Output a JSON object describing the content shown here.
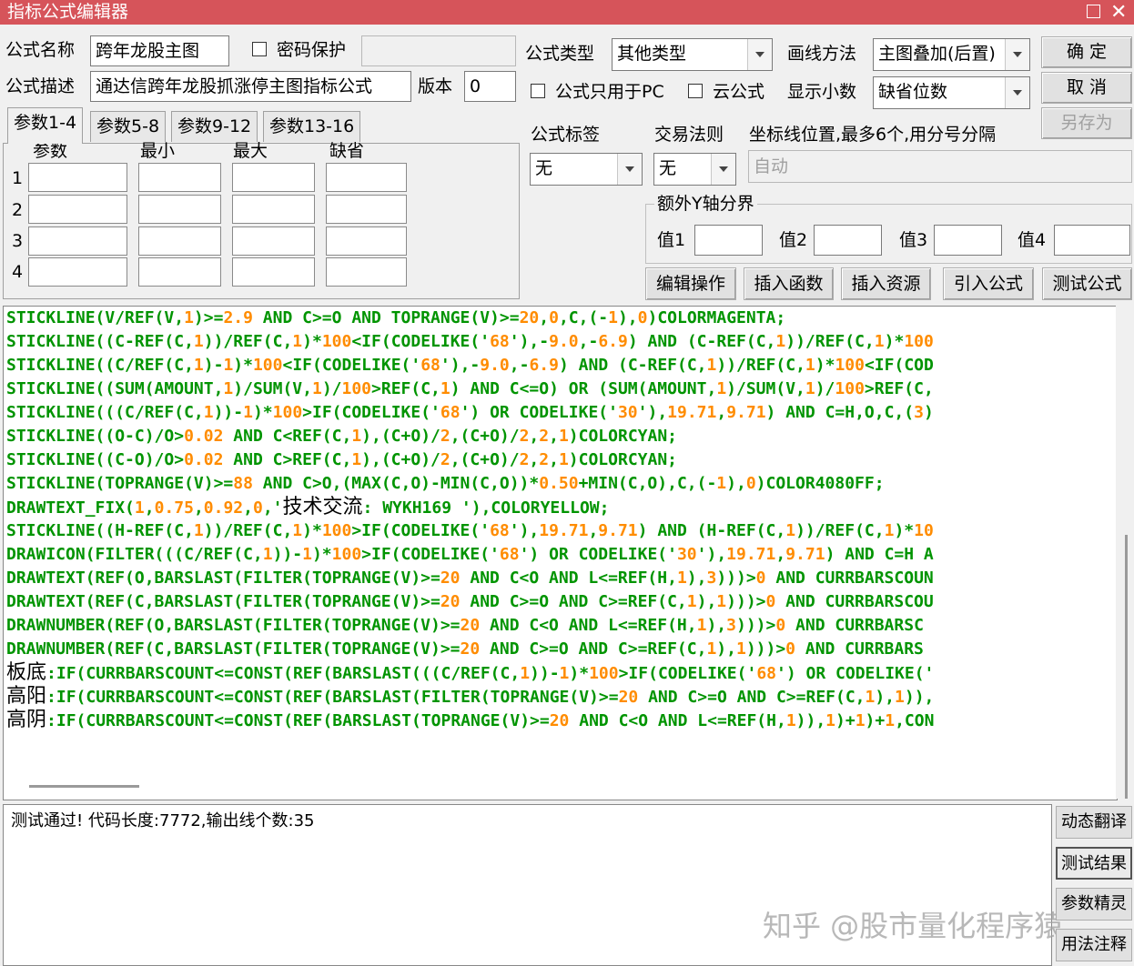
{
  "window": {
    "title": "指标公式编辑器"
  },
  "form": {
    "name_label": "公式名称",
    "name_value": "跨年龙股主图",
    "password_label": "密码保护",
    "type_label": "公式类型",
    "type_value": "其他类型",
    "draw_label": "画线方法",
    "draw_value": "主图叠加(后置)",
    "desc_label": "公式描述",
    "desc_value": "通达信跨年龙股抓涨停主图指标公式",
    "version_label": "版本",
    "version_value": "0",
    "pc_only_label": "公式只用于PC",
    "cloud_label": "云公式",
    "decimals_label": "显示小数",
    "decimals_value": "缺省位数",
    "tag_label": "公式标签",
    "tag_value": "无",
    "rule_label": "交易法则",
    "rule_value": "无",
    "coord_label": "坐标线位置,最多6个,用分号分隔",
    "coord_placeholder": "自动",
    "yaxis_group": "额外Y轴分界",
    "yaxis_values": [
      "值1",
      "值2",
      "值3",
      "值4"
    ]
  },
  "buttons": {
    "ok": "确  定",
    "cancel": "取  消",
    "save_as": "另存为",
    "edit_ops": "编辑操作",
    "insert_func": "插入函数",
    "insert_res": "插入资源",
    "import_formula": "引入公式",
    "test_formula": "测试公式",
    "translate": "动态翻译",
    "test_result": "测试结果",
    "param_wizard": "参数精灵",
    "usage_note": "用法注释"
  },
  "params": {
    "tabs": [
      "参数1-4",
      "参数5-8",
      "参数9-12",
      "参数13-16"
    ],
    "headers": [
      "参数",
      "最小",
      "最大",
      "缺省"
    ],
    "rows": [
      "1",
      "2",
      "3",
      "4"
    ]
  },
  "code_lines": [
    "STICKLINE(V/REF(V,1)>=2.9 AND C>=O AND TOPRANGE(V)>=20,0,C,(-1),0)COLORMAGENTA;",
    "STICKLINE((C-REF(C,1))/REF(C,1)*100<IF(CODELIKE('68'),-9.0,-6.9) AND (C-REF(C,1))/REF(C,1)*100",
    "STICKLINE((C/REF(C,1)-1)*100<IF(CODELIKE('68'),-9.0,-6.9) AND (C-REF(C,1))/REF(C,1)*100<IF(COD",
    "STICKLINE((SUM(AMOUNT,1)/SUM(V,1)/100>REF(C,1) AND C<=O) OR (SUM(AMOUNT,1)/SUM(V,1)/100>REF(C,",
    "STICKLINE(((C/REF(C,1))-1)*100>IF(CODELIKE('68') OR CODELIKE('30'),19.71,9.71) AND C=H,O,C,(3)",
    "STICKLINE((O-C)/O>0.02 AND C<REF(C,1),(C+O)/2,(C+O)/2,2,1)COLORCYAN;",
    "STICKLINE((C-O)/O>0.02 AND C>REF(C,1),(C+O)/2,(C+O)/2,2,1)COLORCYAN;",
    "STICKLINE(TOPRANGE(V)>=88 AND C>O,(MAX(C,O)-MIN(C,O))*0.50+MIN(C,O),C,(-1),0)COLOR4080FF;",
    "DRAWTEXT_FIX(1,0.75,0.92,0,'技术交流: WYKH169 '),COLORYELLOW;",
    "STICKLINE((H-REF(C,1))/REF(C,1)*100>IF(CODELIKE('68'),19.71,9.71) AND (H-REF(C,1))/REF(C,1)*10",
    "DRAWICON(FILTER(((C/REF(C,1))-1)*100>IF(CODELIKE('68') OR CODELIKE('30'),19.71,9.71) AND C=H A",
    "DRAWTEXT(REF(O,BARSLAST(FILTER(TOPRANGE(V)>=20 AND C<O AND L<=REF(H,1),3)))>0 AND CURRBARSCOUN",
    "DRAWTEXT(REF(C,BARSLAST(FILTER(TOPRANGE(V)>=20 AND C>=O AND C>=REF(C,1),1)))>0 AND CURRBARSCOU",
    "DRAWNUMBER(REF(O,BARSLAST(FILTER(TOPRANGE(V)>=20 AND C<O AND L<=REF(H,1),3)))>0 AND CURRBARSC",
    "DRAWNUMBER(REF(C,BARSLAST(FILTER(TOPRANGE(V)>=20 AND C>=O AND C>=REF(C,1),1)))>0 AND CURRBARS",
    "板底:IF(CURRBARSCOUNT<=CONST(REF(BARSLAST(((C/REF(C,1))-1)*100>IF(CODELIKE('68') OR CODELIKE('",
    "高阳:IF(CURRBARSCOUNT<=CONST(REF(BARSLAST(FILTER(TOPRANGE(V)>=20 AND C>=O AND C>=REF(C,1),1)),",
    "高阴:IF(CURRBARSCOUNT<=CONST(REF(BARSLAST(TOPRANGE(V)>=20 AND C<O AND L<=REF(H,1)),1)+1)+1,CON"
  ],
  "output": {
    "text": "测试通过! 代码长度:7772,输出线个数:35"
  },
  "watermark": "知乎 @股市量化程序猿",
  "colors": {
    "title_bar": "#d6545a",
    "code_text": "#009400",
    "code_number": "#ff8c00"
  }
}
